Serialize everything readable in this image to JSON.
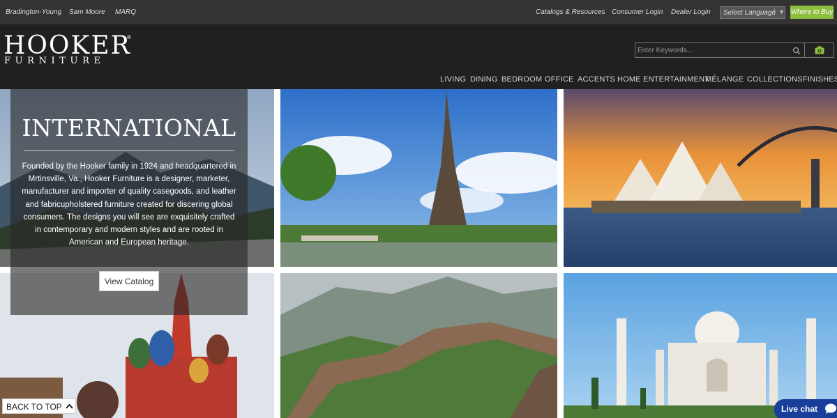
{
  "topbar": {
    "brands": [
      "Bradington-Young",
      "Sam Moore",
      "MARQ"
    ],
    "links": [
      "Catalogs & Resources",
      "Consumer Login",
      "Dealer Login"
    ],
    "language_select": "Select Language",
    "language_sep": "|",
    "language_caret": "▼",
    "where_to_buy": "Where to Buy"
  },
  "header": {
    "logo_main": "HOOKER",
    "logo_reg": "®",
    "logo_sub": "FURNITURE",
    "search_placeholder": "Enter Keywords...",
    "nav": [
      "LIVING",
      "DINING",
      "BEDROOM",
      "OFFICE",
      "ACCENTS",
      "HOME ENTERTAINMENT",
      "MÉLANGE",
      "COLLECTIONS",
      "FINISHES"
    ]
  },
  "intro": {
    "title": "INTERNATIONAL",
    "body": "Founded by the Hooker family in 1924 and headquartered in Mrtinsville, Va., Hooker Furniture is a designer, marketer, manufacturer and importer of quality casegoods, and leather and fabricupholstered furniture created for discering global consumers. The designs you will see are exquisitely crafted in contemporary and modern styles and are rooted in American and European heritage.",
    "button": "View Catalog"
  },
  "footer": {
    "back_to_top": "BACK TO TOP",
    "live_chat": "Live chat"
  },
  "colors": {
    "topbar_bg": "#333333",
    "header_bg": "#202020",
    "where_to_buy_bg": "#8dbf3f",
    "live_chat_bg": "#1a3f9a"
  }
}
